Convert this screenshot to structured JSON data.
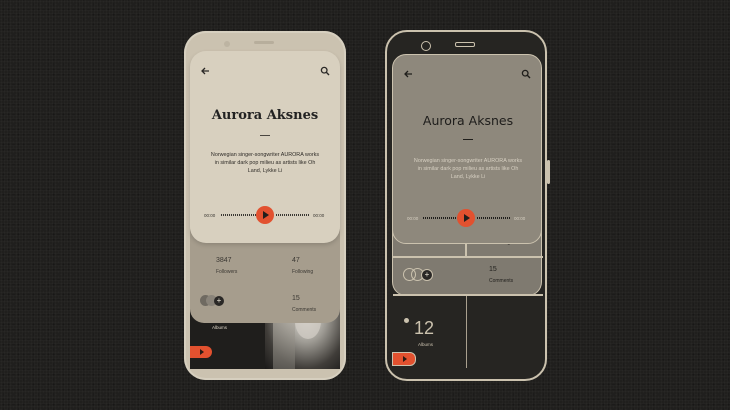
{
  "artist": {
    "name": "Aurora Aksnes"
  },
  "bio": "Norwegian singer-songwriter AURORA works in similar dark pop milieu as artists like Oh Land, Lykke Li",
  "player": {
    "elapsed": "00:00",
    "total": "00:00",
    "progress": 0.5
  },
  "stats": {
    "followers_count": "3847",
    "followers_label": "Followers",
    "following_count": "47",
    "following_label": "Following",
    "comments_count": "15",
    "comments_label": "Comments"
  },
  "albums": {
    "count": "12",
    "label": "Albums"
  },
  "icons": {
    "back": "arrow-left-icon",
    "search": "search-icon",
    "play": "play-icon",
    "plus": "plus-icon",
    "album": "disc-icon"
  },
  "colors": {
    "accent": "#e2512f",
    "card": "#d8d0bf",
    "background": "#201f1d"
  }
}
